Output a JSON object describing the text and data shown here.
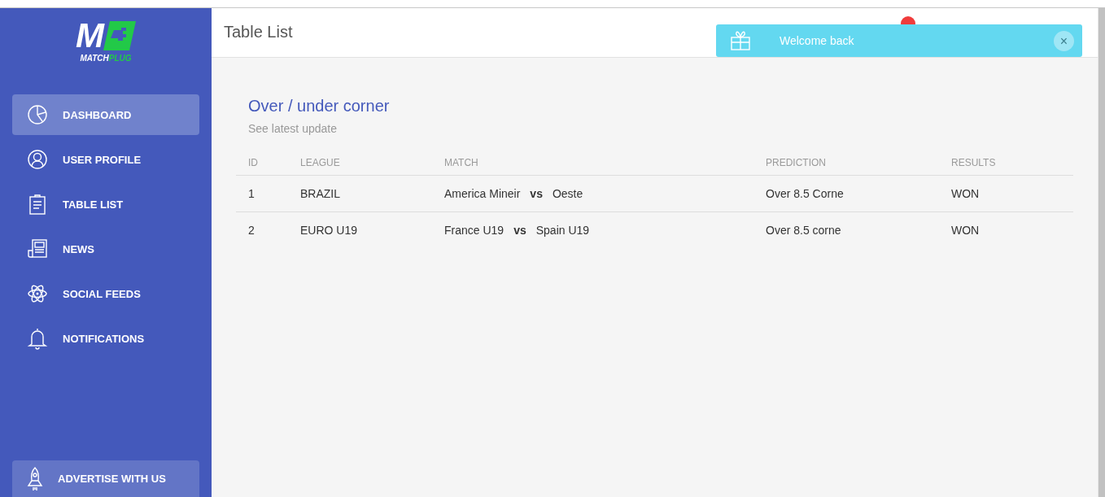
{
  "logo": {
    "letter": "M",
    "name_main": "MATCH",
    "name_accent": "PLUG"
  },
  "sidebar": {
    "items": [
      {
        "label": "DASHBOARD",
        "selected": true
      },
      {
        "label": "USER PROFILE",
        "selected": false
      },
      {
        "label": "TABLE LIST",
        "selected": false
      },
      {
        "label": "NEWS",
        "selected": false
      },
      {
        "label": "SOCIAL FEEDS",
        "selected": false
      },
      {
        "label": "NOTIFICATIONS",
        "selected": false
      }
    ],
    "footer_button": {
      "label": "ADVERTISE WITH US"
    }
  },
  "header": {
    "title": "Table List"
  },
  "toast": {
    "message": "Welcome back",
    "close": "×"
  },
  "card": {
    "title": "Over / under corner",
    "subtitle": "See latest update",
    "table": {
      "columns": [
        "ID",
        "LEAGUE",
        "MATCH",
        "PREDICTION",
        "RESULTS"
      ],
      "rows": [
        {
          "id": "1",
          "league": "BRAZIL",
          "home": "America Mineir",
          "vs": "vs",
          "away": "Oeste",
          "prediction": "Over 8.5 Corne",
          "result": "WON"
        },
        {
          "id": "2",
          "league": "EURO U19",
          "home": "France U19",
          "vs": "vs",
          "away": "Spain U19",
          "prediction": "Over 8.5 corne",
          "result": "WON"
        }
      ]
    }
  }
}
